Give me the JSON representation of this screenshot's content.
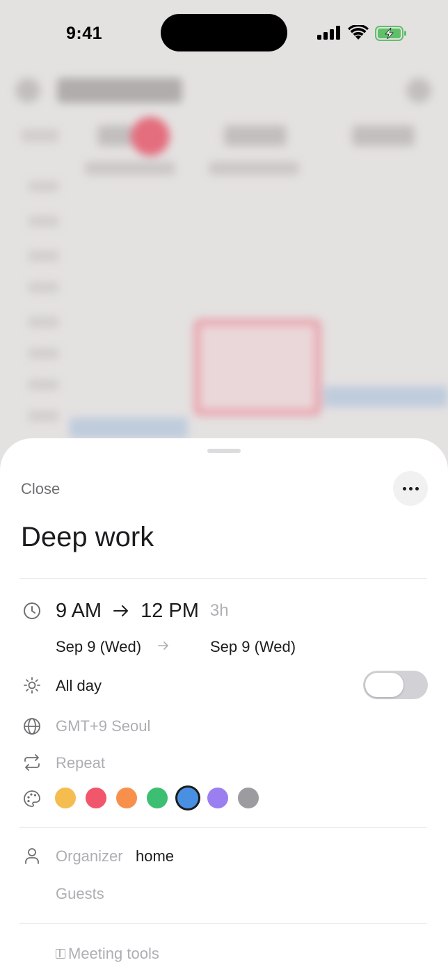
{
  "status_bar": {
    "time": "9:41"
  },
  "sheet": {
    "close_label": "Close",
    "title": "Deep work",
    "start_time": "9 AM",
    "end_time": "12 PM",
    "duration": "3h",
    "start_date": "Sep 9 (Wed)",
    "end_date": "Sep 9 (Wed)",
    "all_day_label": "All day",
    "all_day_enabled": false,
    "timezone": "GMT+9 Seoul",
    "repeat_label": "Repeat",
    "colors": [
      "#f5bd4f",
      "#f2566a",
      "#f8904b",
      "#3cbf72",
      "#4a90e2",
      "#9b7ff0",
      "#9c9ca0"
    ],
    "selected_color": "#4a90e2",
    "organizer_label": "Organizer",
    "organizer_value": "home",
    "guests_placeholder": "Guests",
    "meeting_tools_label": "Meeting tools"
  }
}
